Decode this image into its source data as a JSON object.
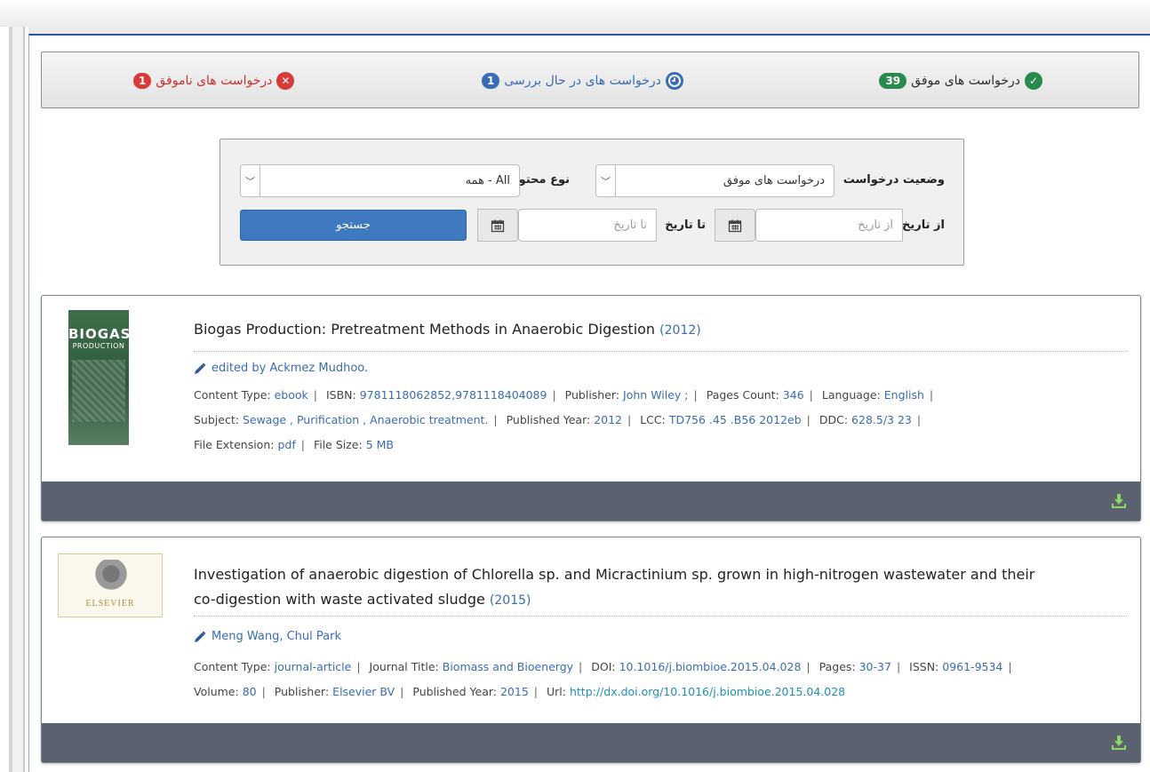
{
  "tabs": {
    "success": {
      "label": "درخواست های موفق",
      "count": "39"
    },
    "pending": {
      "label": "درخواست های در حال بررسی",
      "count": "1"
    },
    "failed": {
      "label": "درخواست های ناموفق",
      "count": "1"
    }
  },
  "search": {
    "status_label": "وضعیت درخواست",
    "status_value": "درخواست های موفق",
    "content_type_label": "نوع محتوی",
    "content_type_value": "All - همه",
    "from_date_label": "از تاریخ",
    "from_date_placeholder": "از تاریخ",
    "to_date_label": "تا تاریخ",
    "to_date_placeholder": "تا تاریخ",
    "submit_label": "جستجو"
  },
  "results": [
    {
      "title": "Biogas Production: Pretreatment Methods in Anaerobic Digestion",
      "year": "(2012)",
      "authors": "edited by Ackmez Mudhoo.",
      "cover_text": {
        "line1": "BIOGAS",
        "line2": "PRODUCTION"
      },
      "meta": {
        "content_type_key": "Content Type:",
        "content_type": "ebook",
        "isbn_key": "ISBN:",
        "isbn": "9781118062852,9781118404089",
        "publisher_key": "Publisher:",
        "publisher": "John Wiley ;",
        "pages_count_key": "Pages Count:",
        "pages_count": "346",
        "language_key": "Language:",
        "language": "English",
        "subject_key": "Subject:",
        "subject": "Sewage , Purification , Anaerobic treatment.",
        "published_year_key": "Published Year:",
        "published_year": "2012",
        "lcc_key": "LCC:",
        "lcc": "TD756 .45 .B56 2012eb",
        "ddc_key": "DDC:",
        "ddc": "628.5/3 23",
        "file_ext_key": "File Extension:",
        "file_ext": "pdf",
        "file_size_key": "File Size:",
        "file_size": "5 MB"
      }
    },
    {
      "title_line1": "Investigation of anaerobic digestion of Chlorella sp. and Micractinium sp. grown in high-nitrogen wastewater and their",
      "title_line2": "co-digestion with waste activated sludge",
      "year": "(2015)",
      "authors": "Meng Wang, Chul Park",
      "cover_text": {
        "line1": "ELSEVIER"
      },
      "meta": {
        "content_type_key": "Content Type:",
        "content_type": "journal-article",
        "journal_key": "Journal Title:",
        "journal": "Biomass and Bioenergy",
        "doi_key": "DOI:",
        "doi": "10.1016/j.biombioe.2015.04.028",
        "pages_key": "Pages:",
        "pages": "30-37",
        "issn_key": "ISSN:",
        "issn": "0961-9534",
        "volume_key": "Volume:",
        "volume": "80",
        "publisher_key": "Publisher:",
        "publisher": "Elsevier BV",
        "published_year_key": "Published Year:",
        "published_year": "2015",
        "url_key": "Url:",
        "url": "http://dx.doi.org/10.1016/j.biombioe.2015.04.028"
      }
    }
  ],
  "colors": {
    "accent": "#3a6cb5",
    "success": "#2a8a4e",
    "danger": "#d83a3a",
    "card_footer": "#5a6270"
  },
  "icons": [
    "check-circle-icon",
    "clock-icon",
    "x-circle-icon",
    "calendar-icon",
    "pencil-icon",
    "download-icon",
    "chevron-down-icon"
  ]
}
